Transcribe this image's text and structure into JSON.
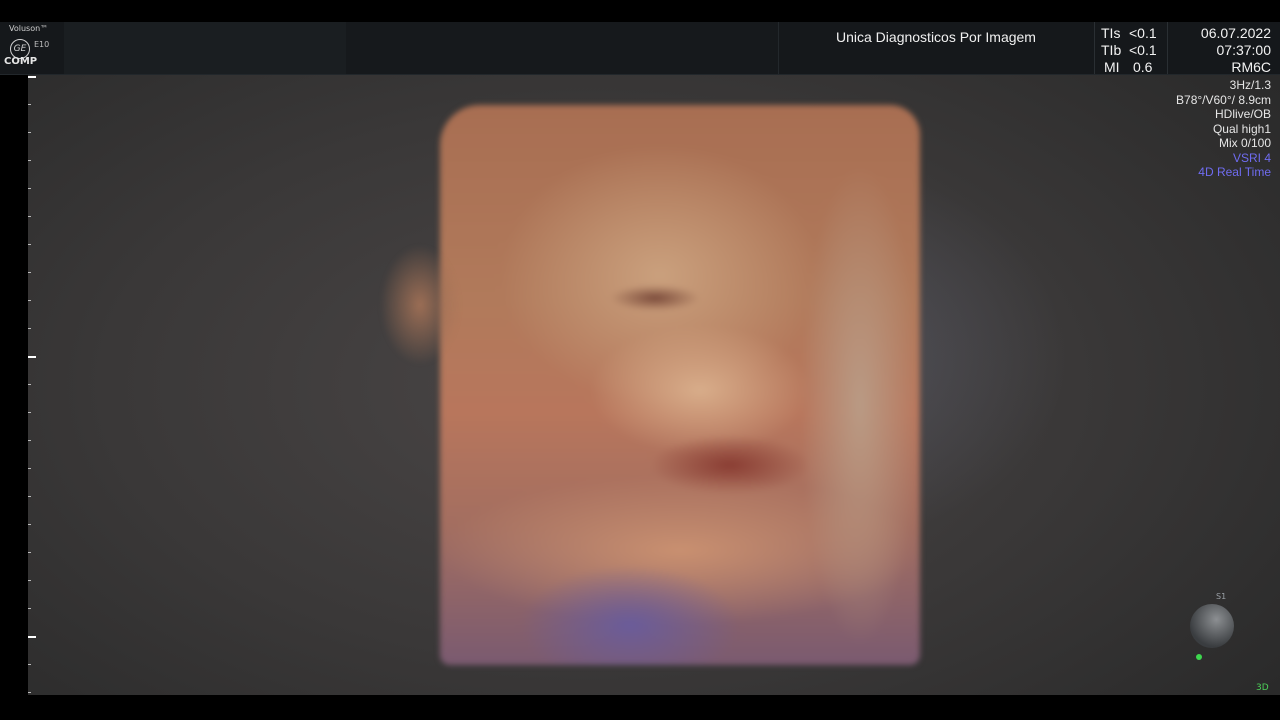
{
  "header": {
    "brand": "Voluson™",
    "logo_text": "GE",
    "model": "E10",
    "mode_label": "COMP",
    "institution": "Unica Diagnosticos Por Imagem",
    "indices": [
      {
        "label": "TIs",
        "value": "<0.1"
      },
      {
        "label": "TIb",
        "value": "<0.1"
      },
      {
        "label": "MI",
        "value": "0.6"
      }
    ],
    "date": "06.07.2022",
    "time": "07:37:00",
    "probe": "RM6C"
  },
  "params": {
    "frame_rate": "3Hz/1.3",
    "volume_angles": "B78°/V60°/ 8.9cm",
    "render_mode": "HDlive/OB",
    "quality": "Qual high1",
    "mix": "Mix 0/100",
    "vsri": "VSRI 4",
    "mode": "4D Real Time",
    "accent_color": "#6f6cf0"
  },
  "orientation": {
    "label": "S1",
    "badge": "3D",
    "badge_color": "#4ccf58"
  }
}
